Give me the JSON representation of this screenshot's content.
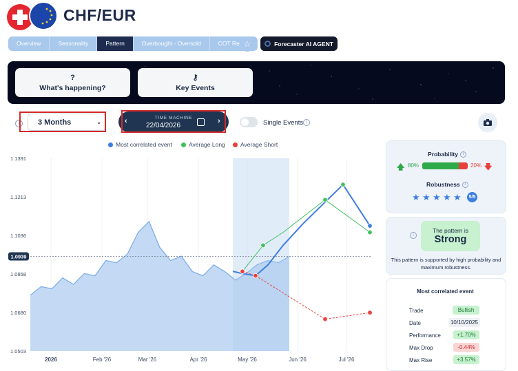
{
  "header": {
    "title": "CHF/EUR",
    "flag_left": "swiss-flag-icon",
    "flag_right": "eu-flag-icon"
  },
  "tabs": [
    {
      "label": "Overview",
      "active": false
    },
    {
      "label": "Seasonality",
      "active": false
    },
    {
      "label": "Pattern",
      "active": true
    },
    {
      "label": "Overbought - Oversold",
      "active": false
    },
    {
      "label": "COT Report",
      "active": false
    }
  ],
  "agent_button": "Forecaster AI AGENT",
  "banner": {
    "card1": {
      "label": "What's happening?",
      "icon": "?"
    },
    "card2": {
      "label": "Key Events",
      "icon": "key-icon"
    }
  },
  "controls": {
    "period": "3 Months",
    "time_machine": {
      "label": "TIME MACHINE",
      "date": "22/04/2026"
    },
    "single_events": {
      "label": "Single Events",
      "on": false
    }
  },
  "legend": [
    {
      "label": "Most correlated event",
      "color": "#3f7ee0"
    },
    {
      "label": "Average Long",
      "color": "#3ec15a"
    },
    {
      "label": "Average Short",
      "color": "#e8413c"
    }
  ],
  "chart_data": {
    "type": "line",
    "yticks": [
      "1.1391",
      "1.1213",
      "1.1036",
      "1.0858",
      "1.0680",
      "1.0503"
    ],
    "ylim": [
      1.0503,
      1.1391
    ],
    "current_value": "1.0939",
    "xticks": [
      "2026",
      "Feb '26",
      "Mar '26",
      "Apr '26",
      "May '26",
      "Jun '26",
      "Jul '26"
    ],
    "series": [
      {
        "name": "Most correlated event",
        "values": [
          1.076,
          1.08,
          1.079,
          1.084,
          1.081,
          1.086,
          1.085,
          1.092,
          1.091,
          1.095,
          1.105,
          1.11,
          1.098,
          1.092,
          1.094,
          1.087,
          1.085,
          1.09,
          1.087,
          1.083,
          1.086,
          1.09,
          1.092,
          1.091,
          1.0939
        ]
      },
      {
        "name": "Most correlated event",
        "values": [
          1.087,
          1.086,
          1.085,
          1.09,
          1.099,
          1.109,
          1.127,
          1.108
        ]
      },
      {
        "name": "Average Long",
        "values": [
          1.087,
          1.099,
          1.105,
          1.12,
          1.105
        ]
      },
      {
        "name": "Average Short",
        "values": [
          1.087,
          1.085,
          1.065,
          1.068
        ]
      }
    ]
  },
  "probability": {
    "label": "Probability",
    "up_pct": "80%",
    "down_pct": "20%",
    "up_value": 80
  },
  "robustness": {
    "label": "Robustness",
    "score": "5/5",
    "stars": 5
  },
  "pattern": {
    "line1": "The pattern is",
    "line2": "Strong",
    "desc": "This pattern is supported by high probability and maximum robustness."
  },
  "correlated": {
    "title": "Most correlated event",
    "rows": [
      {
        "label": "Trade",
        "value": "Bullish",
        "style": "green"
      },
      {
        "label": "Date",
        "value": "10/10/2025",
        "style": "gray"
      },
      {
        "label": "Performance",
        "value": "+1.70%",
        "style": "green"
      },
      {
        "label": "Max Drop",
        "value": "-0.44%",
        "style": "red"
      },
      {
        "label": "Max Rise",
        "value": "+3.57%",
        "style": "green"
      }
    ]
  }
}
